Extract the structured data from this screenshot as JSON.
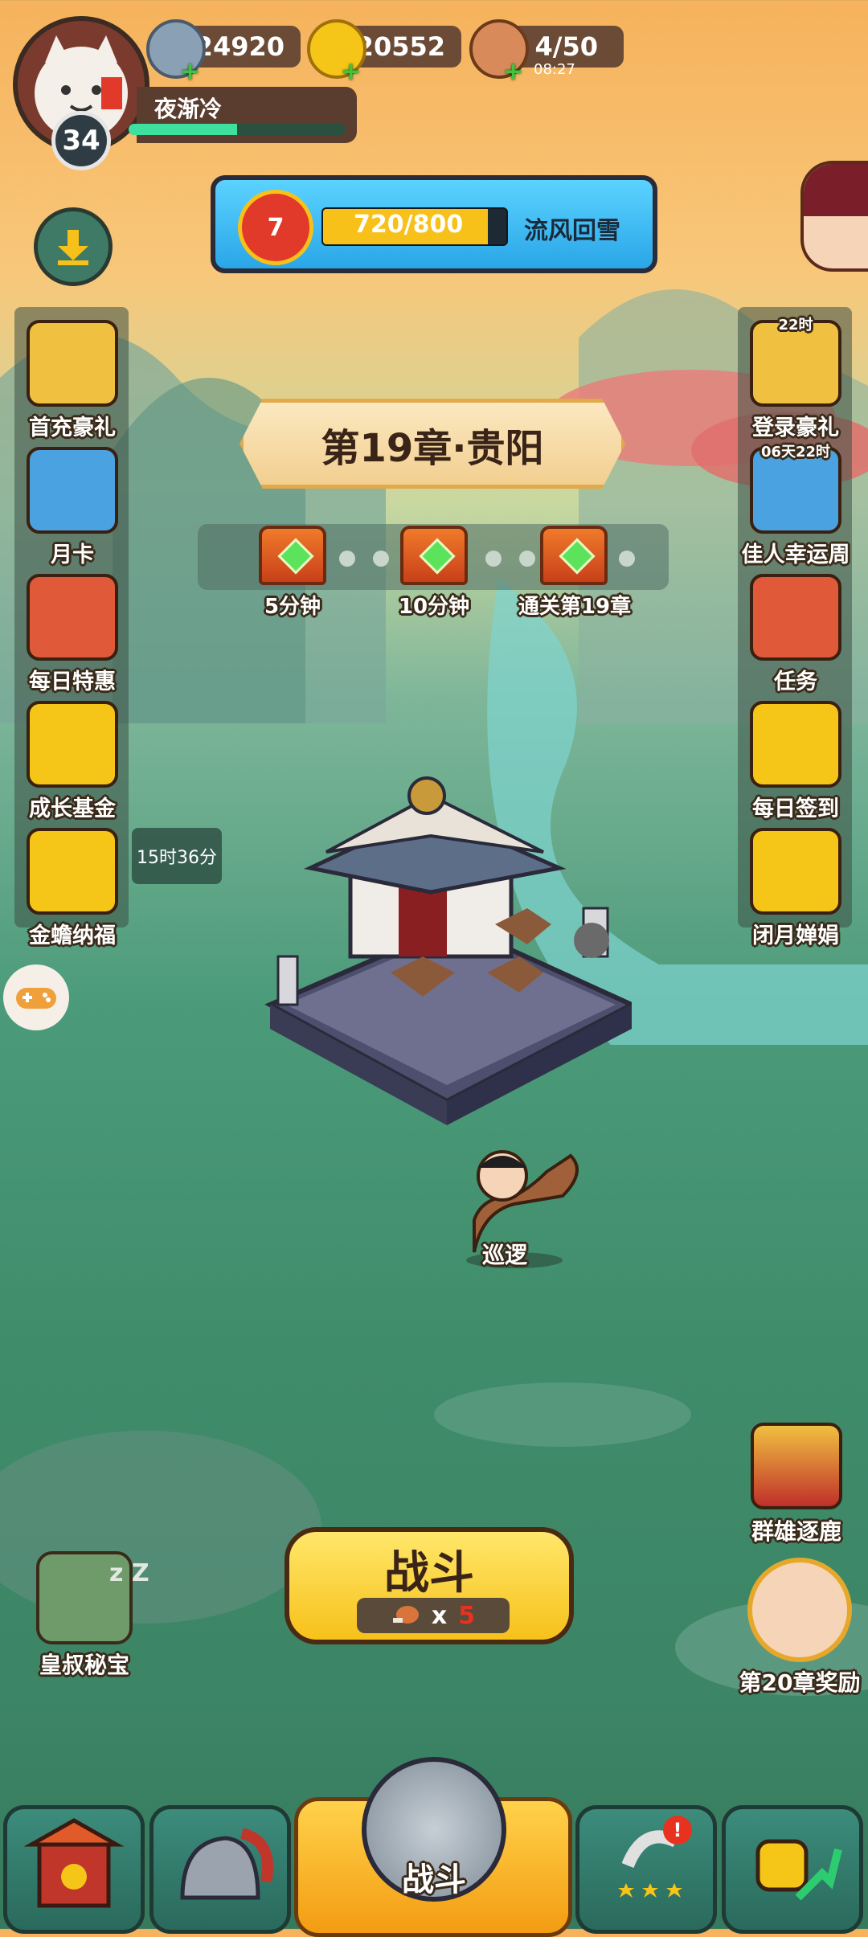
{
  "player": {
    "name": "夜渐冷",
    "level": "34",
    "exp_fraction": 0.5
  },
  "resources": {
    "silver": "24920",
    "gold": "20552",
    "stamina": "4/50",
    "stamina_timer": "08:27"
  },
  "quest": {
    "level": "7",
    "progress_text": "720/800",
    "progress_fraction": 0.9,
    "title": "流风回雪"
  },
  "chapter": {
    "title": "第19章·贵阳"
  },
  "chapter_rewards": [
    "5分钟",
    "10分钟",
    "通关第19章"
  ],
  "left_menu": [
    {
      "label": "首充豪礼",
      "icon": "treasure-chest-icon"
    },
    {
      "label": "月卡",
      "icon": "calendar-card-icon"
    },
    {
      "label": "每日特惠",
      "icon": "gift-bag-icon"
    },
    {
      "label": "成长基金",
      "icon": "fortune-god-icon"
    },
    {
      "label": "金蟾纳福",
      "icon": "golden-toad-icon"
    }
  ],
  "left_timer": "15时36分",
  "right_menu": [
    {
      "label": "登录豪礼",
      "badge": "22时",
      "icon": "login-gift-icon"
    },
    {
      "label": "佳人幸运周",
      "badge": "06天22时",
      "icon": "beauty-icon"
    },
    {
      "label": "任务",
      "badge": "",
      "icon": "scroll-icon"
    },
    {
      "label": "每日签到",
      "badge": "",
      "icon": "sign-in-icon"
    },
    {
      "label": "闭月婵娟",
      "badge": "",
      "icon": "moon-fairy-icon"
    }
  ],
  "patrol_label": "巡逻",
  "lower_right": [
    {
      "label": "群雄逐鹿",
      "icon": "banner-icon"
    },
    {
      "label": "第20章奖励",
      "icon": "heroine-portrait-icon"
    }
  ],
  "lower_left": {
    "label": "皇叔秘宝",
    "icon": "sleeping-uncle-icon",
    "zz": "z Z"
  },
  "fight_button": {
    "label": "战斗",
    "cost_prefix": "x",
    "cost": "5"
  },
  "bottom_nav": {
    "center_label": "战斗"
  },
  "colors": {
    "accent_yellow": "#f7c11a",
    "cost_red": "#e8311f"
  }
}
